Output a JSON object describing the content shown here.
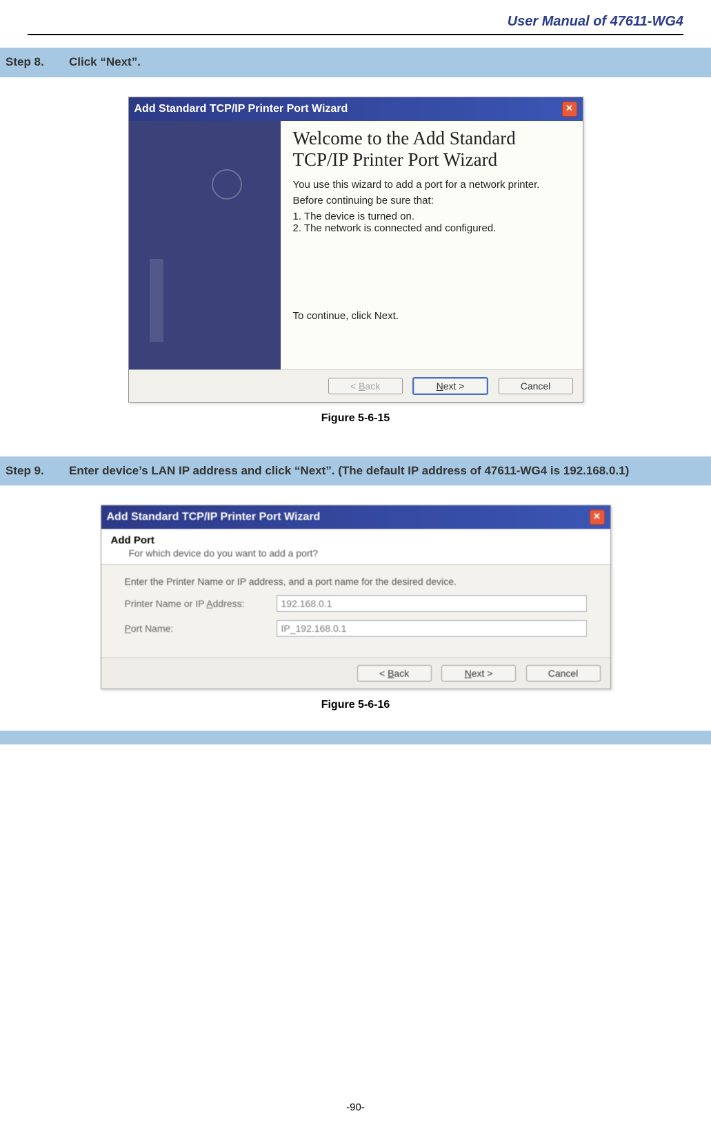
{
  "header": {
    "title": "User Manual of 47611-WG4"
  },
  "step8": {
    "label": "Step 8.",
    "desc": "Click “Next”."
  },
  "wizard1": {
    "title": "Add Standard TCP/IP Printer Port Wizard",
    "heading": "Welcome to the Add Standard TCP/IP Printer Port Wizard",
    "line1": "You use this wizard to add a port for a network printer.",
    "line2": "Before continuing be sure that:",
    "item1": "1.  The device is turned on.",
    "item2": "2.  The network is connected and configured.",
    "continue": "To continue, click Next.",
    "back_prefix": "< ",
    "back_u": "B",
    "back_suffix": "ack",
    "next_u": "N",
    "next_suffix": "ext >",
    "cancel": "Cancel"
  },
  "caption1": "Figure 5-6-15",
  "step9": {
    "label": "Step 9.",
    "desc": "Enter device’s LAN IP address and click “Next”. (The default IP address of 47611-WG4 is 192.168.0.1)"
  },
  "wizard2": {
    "title": "Add Standard TCP/IP Printer Port Wizard",
    "h1": "Add Port",
    "h2": "For which device do you want to add a port?",
    "instr": "Enter the Printer Name or IP address, and a port name for the desired device.",
    "label_ip_prefix": "Printer Name or IP ",
    "label_ip_u": "A",
    "label_ip_suffix": "ddress:",
    "label_port_u": "P",
    "label_port_suffix": "ort Name:",
    "val_ip": "192.168.0.1",
    "val_port": "IP_192.168.0.1",
    "back_prefix": "< ",
    "back_u": "B",
    "back_suffix": "ack",
    "next_u": "N",
    "next_suffix": "ext >",
    "cancel": "Cancel"
  },
  "caption2": "Figure 5-6-16",
  "page_num": "-90-"
}
